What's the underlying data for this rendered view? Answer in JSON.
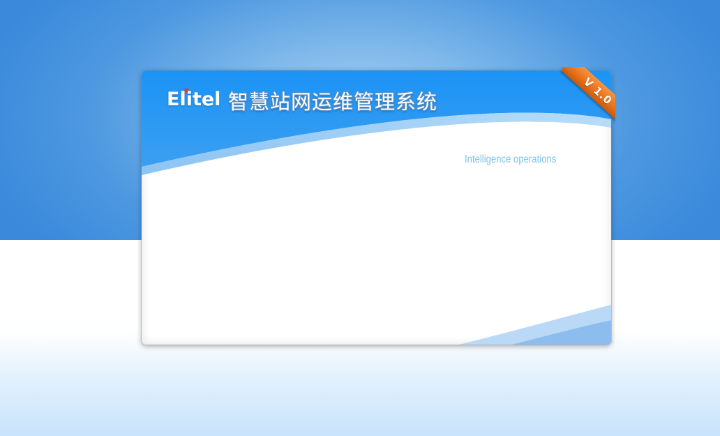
{
  "brand": {
    "logo_text": "Elitel",
    "logo_mark_color": "#e23a3a",
    "system_title": "智慧站网运维管理系统",
    "subtitle": "Intelligence operations",
    "version": "V 1.0"
  },
  "colors": {
    "header_blue": "#1a8bef",
    "background_blue": "#3a89db",
    "ribbon_orange": "#e9731b",
    "subtitle_color": "#7ec3ea"
  }
}
